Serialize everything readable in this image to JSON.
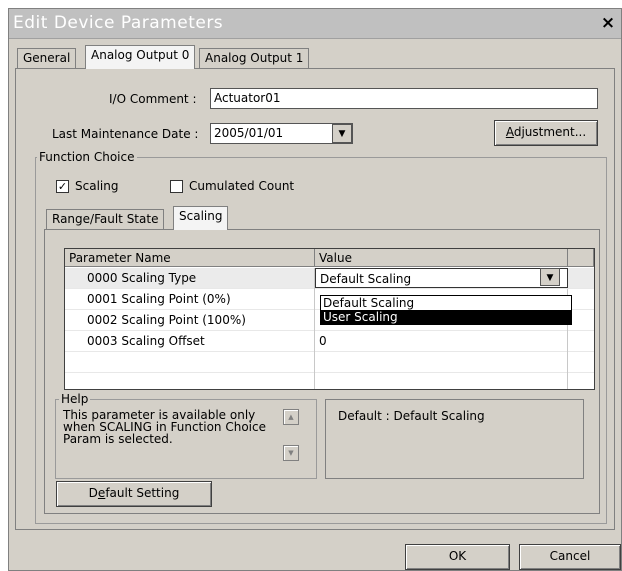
{
  "window": {
    "title": "Edit Device Parameters",
    "close_glyph": "×"
  },
  "tabs": [
    {
      "label": "General"
    },
    {
      "label": "Analog Output 0"
    },
    {
      "label": "Analog Output 1"
    }
  ],
  "io_comment": {
    "label": "I/O Comment :",
    "value": "Actuator01"
  },
  "maintenance": {
    "label": "Last Maintenance Date :",
    "value": "2005/01/01",
    "button_pre": "",
    "button_ul": "A",
    "button_post": "djustment..."
  },
  "function_choice": {
    "title": "Function Choice",
    "scaling": {
      "label": "Scaling",
      "checked": true
    },
    "cumulated": {
      "label": "Cumulated Count",
      "checked": false
    }
  },
  "subtabs": [
    {
      "label": "Range/Fault State"
    },
    {
      "label": "Scaling"
    }
  ],
  "grid": {
    "headers": [
      "Parameter Name",
      "Value"
    ],
    "rows": [
      {
        "name": "0000 Scaling Type",
        "value": "Default Scaling"
      },
      {
        "name": "0001 Scaling Point (0%)",
        "value": ""
      },
      {
        "name": "0002 Scaling Point (100%)",
        "value": ""
      },
      {
        "name": "0003 Scaling Offset",
        "value": "0"
      }
    ]
  },
  "dropdown": {
    "options": [
      "Default Scaling",
      "User Scaling"
    ],
    "selected": "User Scaling"
  },
  "help": {
    "title": "Help",
    "line1": "This parameter is available only",
    "line2": "when SCALING in Function Choice",
    "line3": "Param is selected.",
    "default_text": "Default : Default Scaling"
  },
  "default_button": {
    "pre": "D",
    "ul": "e",
    "post": "fault Setting"
  },
  "footer": {
    "ok": "OK",
    "cancel": "Cancel"
  }
}
